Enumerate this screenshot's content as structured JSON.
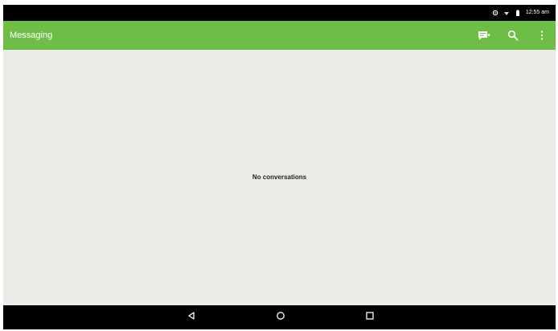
{
  "status_bar": {
    "time": "12:55 am",
    "icons": [
      "sync-icon",
      "wifi-icon",
      "battery-icon"
    ]
  },
  "app_bar": {
    "title": "Messaging",
    "actions": [
      "compose-message-icon",
      "search-icon",
      "overflow-menu-icon"
    ]
  },
  "main": {
    "empty_message": "No conversations"
  },
  "nav_bar": {
    "buttons": [
      "back-icon",
      "home-icon",
      "recents-icon"
    ]
  },
  "colors": {
    "app_bar": "#6dbd47",
    "content_bg": "#ebebe7",
    "system_bars": "#000000"
  }
}
